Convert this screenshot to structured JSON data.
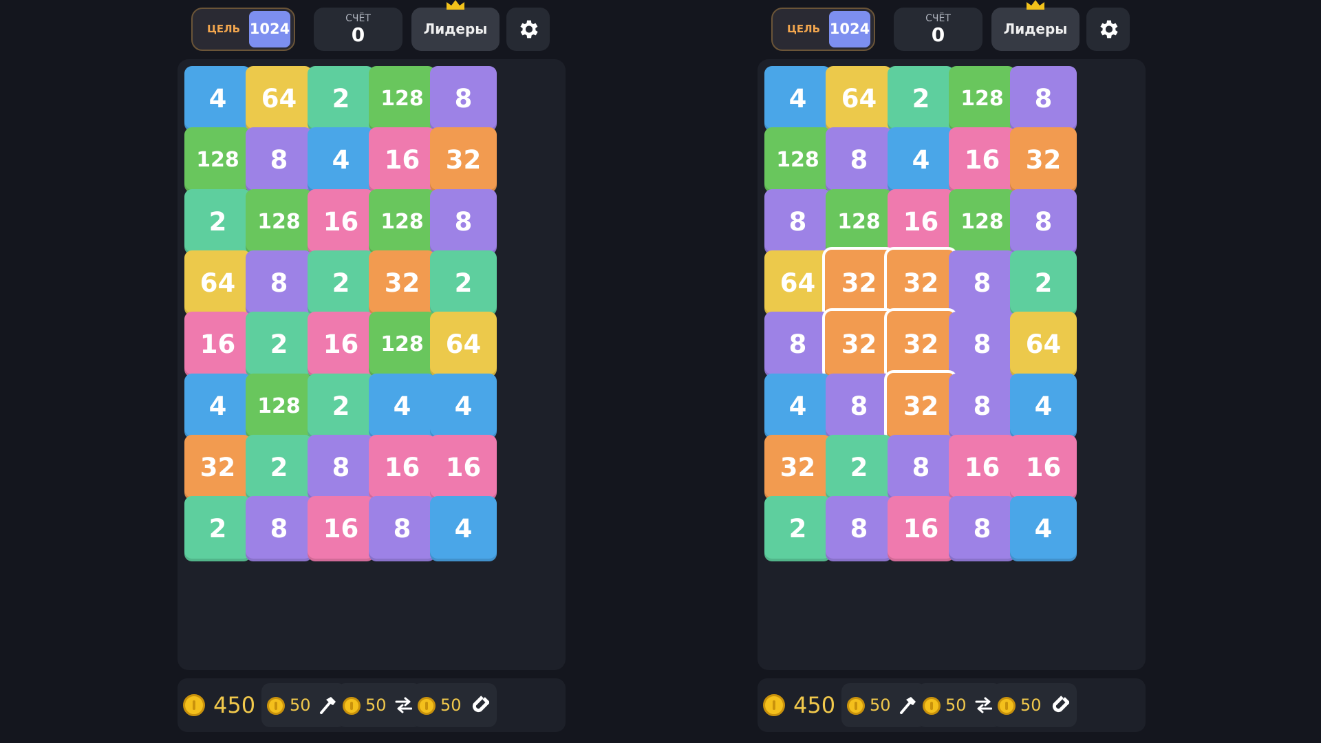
{
  "colors": {
    "2": "#5ecf9e",
    "4": "#4aa6e8",
    "8": "#9d82e6",
    "16": "#ef7aae",
    "32": "#f29b50",
    "64": "#ecc94b",
    "128": "#69c65d",
    "background": "#14161e",
    "panel": "#1d2029",
    "goal_accent": "#7d8ff0",
    "coin": "#f4c01c"
  },
  "panels": [
    {
      "goal_label": "ЦЕЛЬ",
      "goal_value": "1024",
      "score_label": "СЧЁТ",
      "score_value": "0",
      "leaders_label": "Лидеры",
      "coins": "450",
      "boosters": [
        {
          "cost": "50",
          "icon": "hammer-icon"
        },
        {
          "cost": "50",
          "icon": "swap-icon"
        },
        {
          "cost": "50",
          "icon": "magnet-icon"
        }
      ],
      "grid": [
        [
          4,
          64,
          2,
          128,
          8
        ],
        [
          128,
          8,
          4,
          16,
          32
        ],
        [
          2,
          128,
          16,
          128,
          8
        ],
        [
          64,
          8,
          2,
          32,
          2
        ],
        [
          16,
          2,
          16,
          128,
          64
        ],
        [
          4,
          128,
          2,
          4,
          4
        ],
        [
          32,
          2,
          8,
          16,
          16
        ],
        [
          2,
          8,
          16,
          8,
          4
        ]
      ],
      "selected": []
    },
    {
      "goal_label": "ЦЕЛЬ",
      "goal_value": "1024",
      "score_label": "СЧЁТ",
      "score_value": "0",
      "leaders_label": "Лидеры",
      "coins": "450",
      "boosters": [
        {
          "cost": "50",
          "icon": "hammer-icon"
        },
        {
          "cost": "50",
          "icon": "swap-icon"
        },
        {
          "cost": "50",
          "icon": "magnet-icon"
        }
      ],
      "grid": [
        [
          4,
          64,
          2,
          128,
          8
        ],
        [
          128,
          8,
          4,
          16,
          32
        ],
        [
          8,
          128,
          16,
          128,
          8
        ],
        [
          64,
          32,
          32,
          8,
          2
        ],
        [
          8,
          32,
          32,
          8,
          64
        ],
        [
          4,
          8,
          32,
          8,
          4
        ],
        [
          32,
          2,
          8,
          16,
          16
        ],
        [
          2,
          8,
          16,
          8,
          4
        ]
      ],
      "selected": [
        [
          3,
          1
        ],
        [
          3,
          2
        ],
        [
          4,
          1
        ],
        [
          4,
          2
        ],
        [
          5,
          2
        ]
      ]
    }
  ]
}
